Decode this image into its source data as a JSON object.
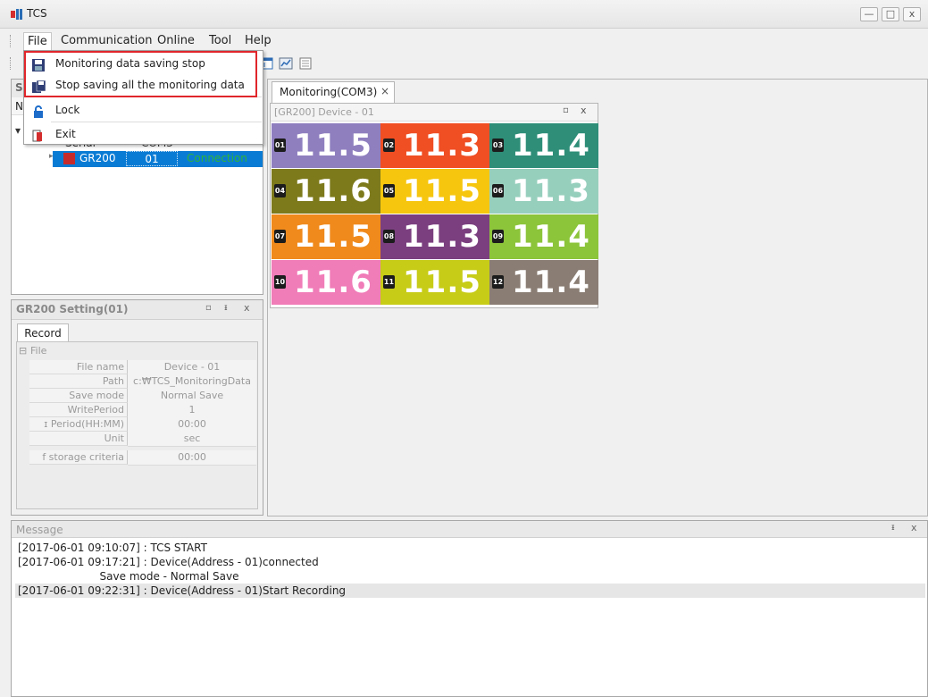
{
  "window": {
    "title": "TCS",
    "minimize_glyph": "—",
    "maximize_glyph": "□",
    "close_glyph": "x"
  },
  "menubar": {
    "items": [
      "File",
      "Communication",
      "Online",
      "Tool",
      "Help"
    ]
  },
  "file_menu": {
    "items": [
      {
        "label": "Monitoring data saving stop",
        "icon": "save-icon"
      },
      {
        "label": "Stop saving all the monitoring data",
        "icon": "save-all-icon"
      },
      {
        "label": "Lock",
        "icon": "lock-icon"
      },
      {
        "label": "Exit",
        "icon": "exit-icon"
      }
    ]
  },
  "tree_panel": {
    "title_fragment": "S",
    "col_fragment": "N",
    "serial_fragment": "Serial",
    "com_fragment": "COM3",
    "device": {
      "name": "GR200",
      "address": "01",
      "status": "Connection"
    }
  },
  "monitoring": {
    "tab_label": "Monitoring(COM3)",
    "tab_close": "×",
    "device_title": "[GR200] Device - 01",
    "tiles": [
      {
        "num": "01",
        "value": "11.5",
        "color": "#8f7fbf"
      },
      {
        "num": "02",
        "value": "11.3",
        "color": "#f04e23"
      },
      {
        "num": "03",
        "value": "11.4",
        "color": "#2e8e78"
      },
      {
        "num": "04",
        "value": "11.6",
        "color": "#7d7a1c"
      },
      {
        "num": "05",
        "value": "11.5",
        "color": "#f6c60f"
      },
      {
        "num": "06",
        "value": "11.3",
        "color": "#97cfbd"
      },
      {
        "num": "07",
        "value": "11.5",
        "color": "#f08a1c"
      },
      {
        "num": "08",
        "value": "11.3",
        "color": "#7b3f7f"
      },
      {
        "num": "09",
        "value": "11.4",
        "color": "#8cc43a"
      },
      {
        "num": "10",
        "value": "11.6",
        "color": "#f07cb8"
      },
      {
        "num": "11",
        "value": "11.5",
        "color": "#c7cc17"
      },
      {
        "num": "12",
        "value": "11.4",
        "color": "#8a7d73"
      }
    ]
  },
  "settings": {
    "title": "GR200 Setting(01)",
    "tab": "Record",
    "group": "File",
    "rows": [
      {
        "key": "File name",
        "value": "Device - 01"
      },
      {
        "key": "Path",
        "value": "c:₩TCS_MonitoringData"
      },
      {
        "key": "Save mode",
        "value": "Normal Save"
      },
      {
        "key": "WritePeriod",
        "value": "1"
      },
      {
        "key": "ɪ Period(HH:MM)",
        "value": "00:00"
      },
      {
        "key": "Unit",
        "value": "sec"
      },
      {
        "key": "f storage criteria",
        "value": "00:00"
      }
    ]
  },
  "message": {
    "title": "Message",
    "lines": [
      "[2017-06-01 09:10:07] : TCS START",
      "[2017-06-01 09:17:21] : Device(Address - 01)connected",
      "                        Save mode - Normal Save",
      "[2017-06-01 09:22:31] : Device(Address - 01)Start Recording"
    ]
  },
  "colors": {
    "selection": "#0a7bd4",
    "highlight_border": "#e0262b"
  }
}
